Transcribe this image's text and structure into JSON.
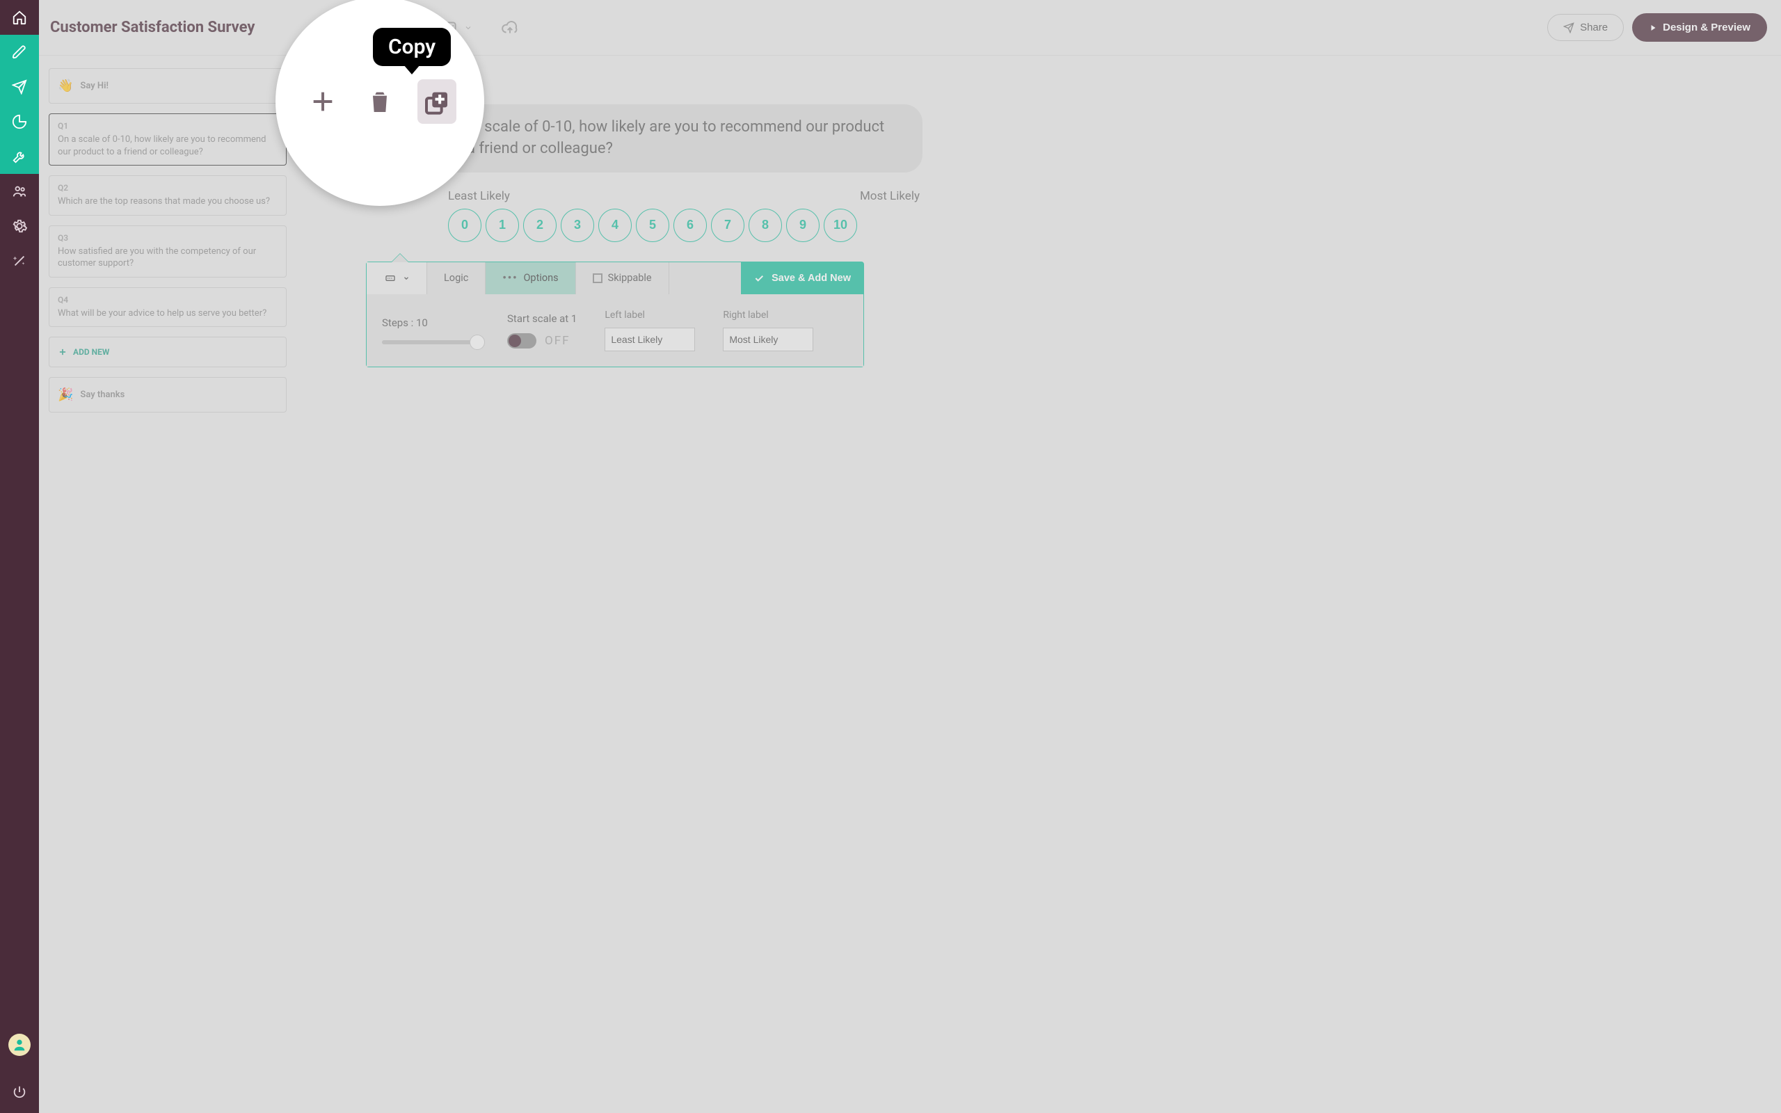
{
  "survey": {
    "title": "Customer Satisfaction Survey",
    "active_question_index": 1,
    "active_question_number": "1"
  },
  "topbar": {
    "share_label": "Share",
    "design_label": "Design & Preview"
  },
  "sidepanel": {
    "intro_label": "Say Hi!",
    "questions": [
      {
        "num": "Q1",
        "text": "On a scale of 0-10, how likely are you to recommend our product to a friend or colleague?"
      },
      {
        "num": "Q2",
        "text": "Which are the top reasons that made you choose us?"
      },
      {
        "num": "Q3",
        "text": "How satisfied are you with the competency of our customer support?"
      },
      {
        "num": "Q4",
        "text": "What will be your advice to help us serve you better?"
      }
    ],
    "addnew_label": "ADD NEW",
    "thanks_label": "Say thanks"
  },
  "question_preview": {
    "prompt": "On a scale of 0-10, how likely are you to recommend our product to a friend or colleague?",
    "left_label": "Least Likely",
    "right_label": "Most Likely",
    "scale_values": [
      "0",
      "1",
      "2",
      "3",
      "4",
      "5",
      "6",
      "7",
      "8",
      "9",
      "10"
    ]
  },
  "settings": {
    "tabs": {
      "logic": "Logic",
      "options": "Options",
      "skippable": "Skippable"
    },
    "save_label": "Save & Add New",
    "steps_label": "Steps : 10",
    "steps_value": 10,
    "start_at_1_label": "Start scale at 1",
    "start_at_1_state": "OFF",
    "left_label_heading": "Left label",
    "right_label_heading": "Right label",
    "left_label_value": "Least Likely",
    "right_label_value": "Most Likely"
  },
  "bubble": {
    "tooltip": "Copy"
  },
  "colors": {
    "accent": "#1abc9c",
    "brand": "#4a2c3a"
  }
}
